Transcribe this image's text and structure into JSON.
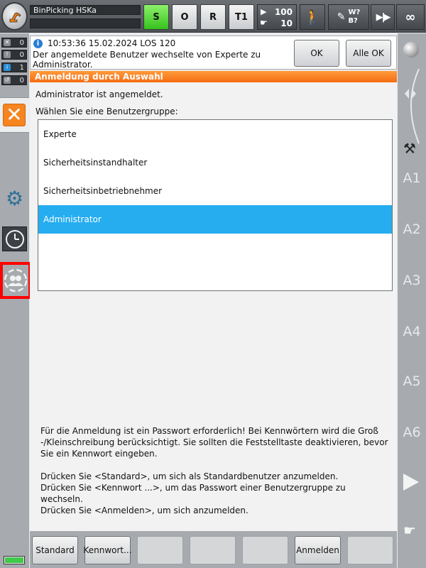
{
  "header": {
    "robot_name": "BinPicking HSKa",
    "submit_state": "S",
    "drives_state": "O",
    "program_state": "R",
    "mode": "T1",
    "override_program": "100",
    "override_jog": "10",
    "tool_label": "W?\nB?",
    "increment": "∞"
  },
  "sidebar": {
    "message_counts": [
      {
        "type": "acknowledge",
        "count": "0"
      },
      {
        "type": "status",
        "count": "0"
      },
      {
        "type": "info",
        "count": "1"
      },
      {
        "type": "wait",
        "count": "0"
      }
    ]
  },
  "message": {
    "timestamp": "10:53:36 15.02.2024 LOS 120",
    "text": "Der angemeldete Benutzer wechselte von Experte zu Administrator.",
    "ok_label": "OK",
    "alle_ok_label": "Alle OK"
  },
  "dialog": {
    "title": "Anmeldung durch Auswahl",
    "logged_in_text": "Administrator ist angemeldet.",
    "choose_label": "Wählen Sie eine Benutzergruppe:",
    "groups": [
      {
        "label": "Experte"
      },
      {
        "label": "Sicherheitsinstandhalter"
      },
      {
        "label": "Sicherheitsinbetriebnehmer"
      },
      {
        "label": "Administrator",
        "selected": true
      }
    ],
    "info_paragraph_1": "Für die Anmeldung ist ein Passwort erforderlich! Bei Kennwörtern wird die Groß -/Kleinschreibung berücksichtigt. Sie sollten die Feststelltaste deaktivieren, bevor Sie ein Kennwort eingeben.",
    "info_line_standard": "Drücken Sie <Standard>, um sich als Standardbenutzer anzumelden.",
    "info_line_kennwort": "Drücken Sie <Kennwort ...>, um das Passwort einer Benutzergruppe zu wechseln.",
    "info_line_anmelden": "Drücken Sie <Anmelden>, um sich anzumelden."
  },
  "right_axes": [
    "A1",
    "A2",
    "A3",
    "A4",
    "A5",
    "A6"
  ],
  "softkeys": {
    "standard": "Standard",
    "kennwort": "Kennwort...",
    "anmelden": "Anmelden"
  },
  "colors": {
    "accent_orange": "#f56c12",
    "selection_blue": "#25adf0",
    "submit_green": "#35c21d",
    "highlight_red": "#ff0000"
  }
}
